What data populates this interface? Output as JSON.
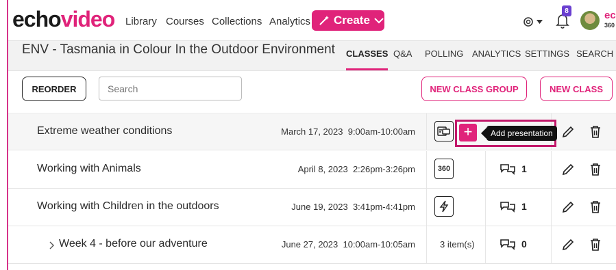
{
  "brand": {
    "part1": "echo",
    "part2": "video"
  },
  "nav": {
    "links": [
      "Library",
      "Courses",
      "Collections",
      "Analytics"
    ],
    "create_label": "Create",
    "notification_count": "8",
    "brand_small_top": "echo",
    "brand_small_bottom": "360"
  },
  "course": {
    "title": "ENV - Tasmania in Colour In the Outdoor Environment",
    "tabs": [
      "CLASSES",
      "Q&A",
      "POLLING",
      "ANALYTICS",
      "SETTINGS",
      "SEARCH"
    ],
    "active_tab": "CLASSES"
  },
  "toolbar": {
    "reorder_label": "REORDER",
    "search_placeholder": "Search",
    "new_group_label": "NEW CLASS GROUP",
    "new_class_label": "NEW CLASS"
  },
  "rows": [
    {
      "title": "Extreme weather conditions",
      "date": "March 17, 2023",
      "time": "9:00am-10:00am",
      "media": "capture-icon"
    },
    {
      "title": "Working with Animals",
      "date": "April 8, 2023",
      "time": "2:26pm-3:26pm",
      "media": "360",
      "qa_count": "1"
    },
    {
      "title": "Working with Children in the outdoors",
      "date": "June 19, 2023",
      "time": "3:41pm-4:41pm",
      "media": "bolt-icon",
      "qa_count": "1"
    },
    {
      "title": "Week 4 - before our adventure",
      "date": "June 27, 2023",
      "time": "10:00am-10:05am",
      "items": "3 item(s)",
      "qa_count": "0"
    }
  ],
  "tooltip": "Add presentation",
  "colors": {
    "accent": "#e0237a",
    "badge": "#6a3fd0"
  }
}
